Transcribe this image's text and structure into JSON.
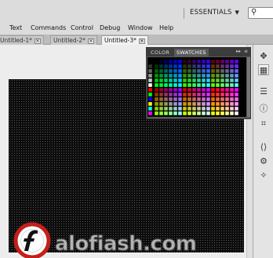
{
  "workspace": {
    "label": "ESSENTIALS",
    "caret": "▼"
  },
  "search": {
    "icon": "search-icon"
  },
  "menu": {
    "items": [
      "Text",
      "Commands",
      "Control",
      "Debug",
      "Window",
      "Help"
    ]
  },
  "tabs": [
    {
      "label": "Untitled-1*",
      "active": false
    },
    {
      "label": "Untitled-2*",
      "active": false
    },
    {
      "label": "Untitled-3*",
      "active": true
    }
  ],
  "swatches_panel": {
    "tabs": [
      {
        "label": "COLOR",
        "active": false
      },
      {
        "label": "SWATCHES",
        "active": true
      }
    ],
    "collapse_glyph": "▸▸",
    "menu_glyph": "≡"
  },
  "right_toolbar": {
    "icons": [
      "transform-icon",
      "swatches-panel-icon",
      "align-icon",
      "info-icon",
      "transform-grid-icon",
      "code-snippets-icon",
      "components-icon",
      "motion-presets-icon"
    ]
  },
  "watermark": {
    "text": "alofiash.com",
    "brand_color": "#d2231e"
  }
}
